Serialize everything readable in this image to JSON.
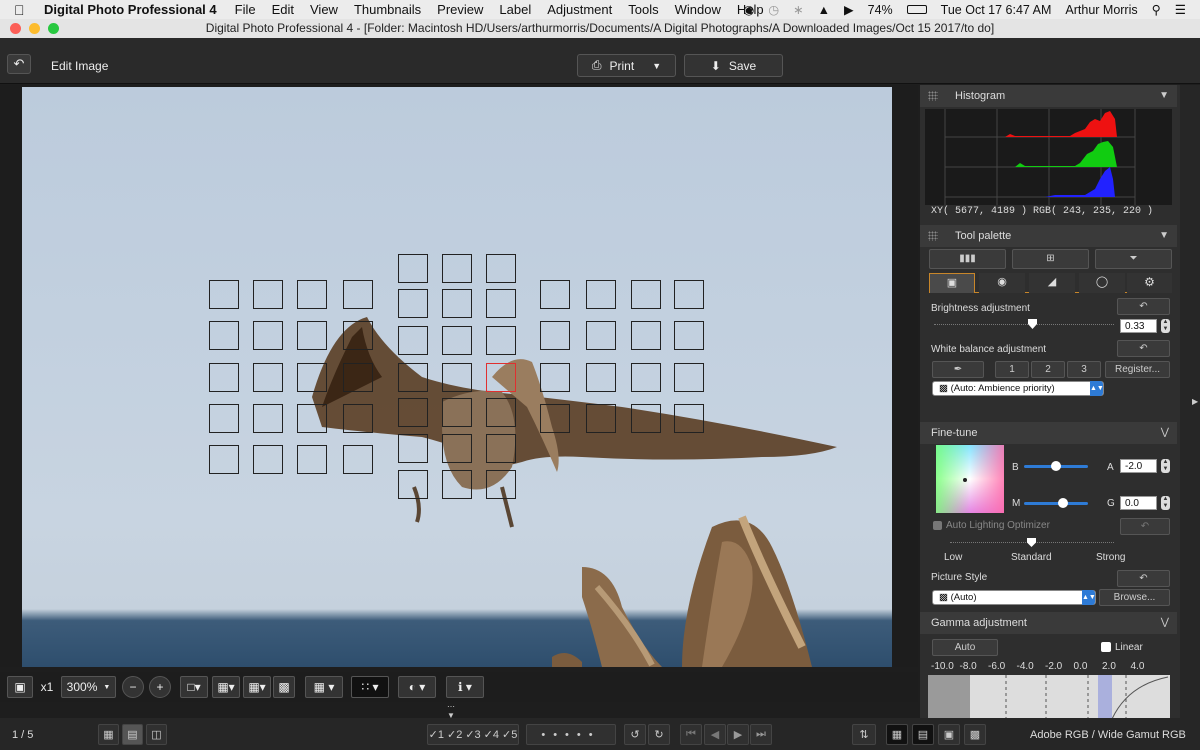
{
  "menubar": {
    "app_name": "Digital Photo Professional 4",
    "items": [
      "File",
      "Edit",
      "View",
      "Thumbnails",
      "Preview",
      "Label",
      "Adjustment",
      "Tools",
      "Window",
      "Help"
    ],
    "battery": "74%",
    "datetime": "Tue Oct 17  6:47 AM",
    "user": "Arthur Morris"
  },
  "window": {
    "title": "Digital Photo Professional 4 - [Folder: Macintosh HD/Users/arthurmorris/Documents/A Digital Photographs/A Downloaded Images/Oct 15 2017/to do]"
  },
  "toolbar": {
    "edit_label": "Edit Image",
    "print_label": "Print",
    "save_label": "Save"
  },
  "histogram": {
    "title": "Histogram",
    "xy_readout": "XY(  5677,   4189 ) RGB( 243, 235, 220 )"
  },
  "tool_palette": {
    "title": "Tool palette",
    "brightness_label": "Brightness adjustment",
    "brightness_value": "0.33",
    "wb_label": "White balance adjustment",
    "wb_buttons": [
      "1",
      "2",
      "3"
    ],
    "register_label": "Register...",
    "wb_select": "(Auto: Ambience priority)"
  },
  "finetune": {
    "title": "Fine-tune",
    "b_label": "B",
    "a_label": "A",
    "a_value": "-2.0",
    "m_label": "M",
    "g_label": "G",
    "g_value": "0.0",
    "alo_label": "Auto Lighting Optimizer",
    "alo_low": "Low",
    "alo_standard": "Standard",
    "alo_strong": "Strong",
    "picture_style_label": "Picture Style",
    "picture_style_value": "(Auto)",
    "browse_label": "Browse..."
  },
  "gamma": {
    "title": "Gamma adjustment",
    "auto_label": "Auto",
    "linear_label": "Linear",
    "scale": [
      "-10.0",
      "-8.0",
      "-6.0",
      "-4.0",
      "-2.0",
      "0.0",
      "2.0",
      "4.0"
    ]
  },
  "zoombar": {
    "x1": "x1",
    "zoom": "300%"
  },
  "status": {
    "page": "1 / 5",
    "ratings": [
      "1",
      "2",
      "3",
      "4",
      "5"
    ],
    "colorspace": "Adobe RGB / Wide Gamut RGB"
  }
}
